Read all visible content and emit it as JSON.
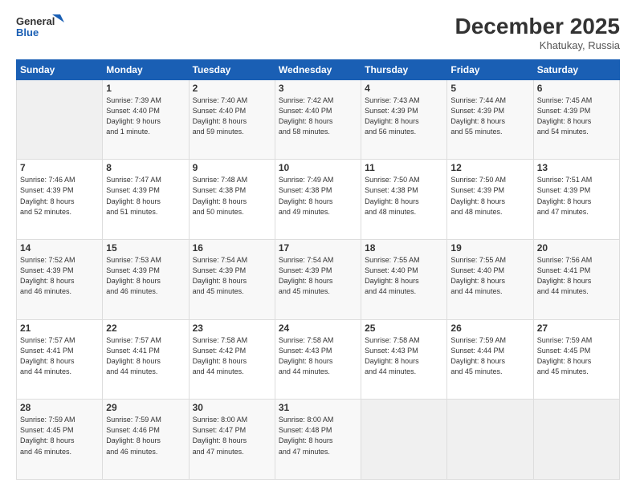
{
  "logo": {
    "line1": "General",
    "line2": "Blue"
  },
  "header": {
    "month": "December 2025",
    "location": "Khatukay, Russia"
  },
  "days_header": [
    "Sunday",
    "Monday",
    "Tuesday",
    "Wednesday",
    "Thursday",
    "Friday",
    "Saturday"
  ],
  "weeks": [
    [
      {
        "day": "",
        "info": ""
      },
      {
        "day": "1",
        "info": "Sunrise: 7:39 AM\nSunset: 4:40 PM\nDaylight: 9 hours\nand 1 minute."
      },
      {
        "day": "2",
        "info": "Sunrise: 7:40 AM\nSunset: 4:40 PM\nDaylight: 8 hours\nand 59 minutes."
      },
      {
        "day": "3",
        "info": "Sunrise: 7:42 AM\nSunset: 4:40 PM\nDaylight: 8 hours\nand 58 minutes."
      },
      {
        "day": "4",
        "info": "Sunrise: 7:43 AM\nSunset: 4:39 PM\nDaylight: 8 hours\nand 56 minutes."
      },
      {
        "day": "5",
        "info": "Sunrise: 7:44 AM\nSunset: 4:39 PM\nDaylight: 8 hours\nand 55 minutes."
      },
      {
        "day": "6",
        "info": "Sunrise: 7:45 AM\nSunset: 4:39 PM\nDaylight: 8 hours\nand 54 minutes."
      }
    ],
    [
      {
        "day": "7",
        "info": "Sunrise: 7:46 AM\nSunset: 4:39 PM\nDaylight: 8 hours\nand 52 minutes."
      },
      {
        "day": "8",
        "info": "Sunrise: 7:47 AM\nSunset: 4:39 PM\nDaylight: 8 hours\nand 51 minutes."
      },
      {
        "day": "9",
        "info": "Sunrise: 7:48 AM\nSunset: 4:38 PM\nDaylight: 8 hours\nand 50 minutes."
      },
      {
        "day": "10",
        "info": "Sunrise: 7:49 AM\nSunset: 4:38 PM\nDaylight: 8 hours\nand 49 minutes."
      },
      {
        "day": "11",
        "info": "Sunrise: 7:50 AM\nSunset: 4:38 PM\nDaylight: 8 hours\nand 48 minutes."
      },
      {
        "day": "12",
        "info": "Sunrise: 7:50 AM\nSunset: 4:39 PM\nDaylight: 8 hours\nand 48 minutes."
      },
      {
        "day": "13",
        "info": "Sunrise: 7:51 AM\nSunset: 4:39 PM\nDaylight: 8 hours\nand 47 minutes."
      }
    ],
    [
      {
        "day": "14",
        "info": "Sunrise: 7:52 AM\nSunset: 4:39 PM\nDaylight: 8 hours\nand 46 minutes."
      },
      {
        "day": "15",
        "info": "Sunrise: 7:53 AM\nSunset: 4:39 PM\nDaylight: 8 hours\nand 46 minutes."
      },
      {
        "day": "16",
        "info": "Sunrise: 7:54 AM\nSunset: 4:39 PM\nDaylight: 8 hours\nand 45 minutes."
      },
      {
        "day": "17",
        "info": "Sunrise: 7:54 AM\nSunset: 4:39 PM\nDaylight: 8 hours\nand 45 minutes."
      },
      {
        "day": "18",
        "info": "Sunrise: 7:55 AM\nSunset: 4:40 PM\nDaylight: 8 hours\nand 44 minutes."
      },
      {
        "day": "19",
        "info": "Sunrise: 7:55 AM\nSunset: 4:40 PM\nDaylight: 8 hours\nand 44 minutes."
      },
      {
        "day": "20",
        "info": "Sunrise: 7:56 AM\nSunset: 4:41 PM\nDaylight: 8 hours\nand 44 minutes."
      }
    ],
    [
      {
        "day": "21",
        "info": "Sunrise: 7:57 AM\nSunset: 4:41 PM\nDaylight: 8 hours\nand 44 minutes."
      },
      {
        "day": "22",
        "info": "Sunrise: 7:57 AM\nSunset: 4:41 PM\nDaylight: 8 hours\nand 44 minutes."
      },
      {
        "day": "23",
        "info": "Sunrise: 7:58 AM\nSunset: 4:42 PM\nDaylight: 8 hours\nand 44 minutes."
      },
      {
        "day": "24",
        "info": "Sunrise: 7:58 AM\nSunset: 4:43 PM\nDaylight: 8 hours\nand 44 minutes."
      },
      {
        "day": "25",
        "info": "Sunrise: 7:58 AM\nSunset: 4:43 PM\nDaylight: 8 hours\nand 44 minutes."
      },
      {
        "day": "26",
        "info": "Sunrise: 7:59 AM\nSunset: 4:44 PM\nDaylight: 8 hours\nand 45 minutes."
      },
      {
        "day": "27",
        "info": "Sunrise: 7:59 AM\nSunset: 4:45 PM\nDaylight: 8 hours\nand 45 minutes."
      }
    ],
    [
      {
        "day": "28",
        "info": "Sunrise: 7:59 AM\nSunset: 4:45 PM\nDaylight: 8 hours\nand 46 minutes."
      },
      {
        "day": "29",
        "info": "Sunrise: 7:59 AM\nSunset: 4:46 PM\nDaylight: 8 hours\nand 46 minutes."
      },
      {
        "day": "30",
        "info": "Sunrise: 8:00 AM\nSunset: 4:47 PM\nDaylight: 8 hours\nand 47 minutes."
      },
      {
        "day": "31",
        "info": "Sunrise: 8:00 AM\nSunset: 4:48 PM\nDaylight: 8 hours\nand 47 minutes."
      },
      {
        "day": "",
        "info": ""
      },
      {
        "day": "",
        "info": ""
      },
      {
        "day": "",
        "info": ""
      }
    ]
  ]
}
